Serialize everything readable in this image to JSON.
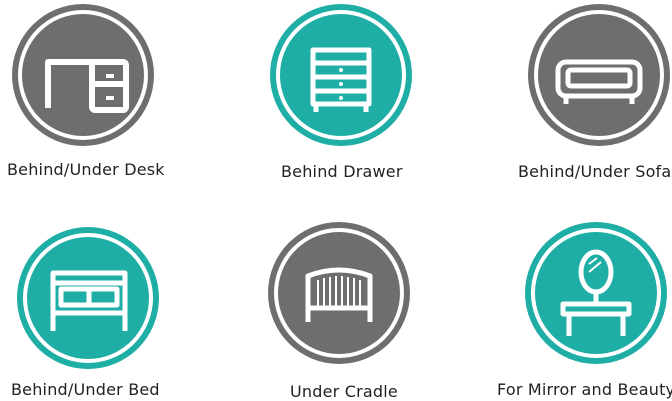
{
  "colors": {
    "gray": "#6e6e70",
    "teal": "#1eaea5",
    "white": "#ffffff"
  },
  "items": [
    {
      "label": "Behind/Under Desk",
      "icon": "desk-icon",
      "color": "gray"
    },
    {
      "label": "Behind Drawer",
      "icon": "drawer-icon",
      "color": "teal"
    },
    {
      "label": "Behind/Under Sofa",
      "icon": "sofa-icon",
      "color": "gray"
    },
    {
      "label": "Behind/Under Bed",
      "icon": "bed-icon",
      "color": "teal"
    },
    {
      "label": "Under Cradle",
      "icon": "cradle-icon",
      "color": "gray"
    },
    {
      "label": "For Mirror and Beauty",
      "icon": "vanity-mirror-icon",
      "color": "teal"
    }
  ]
}
